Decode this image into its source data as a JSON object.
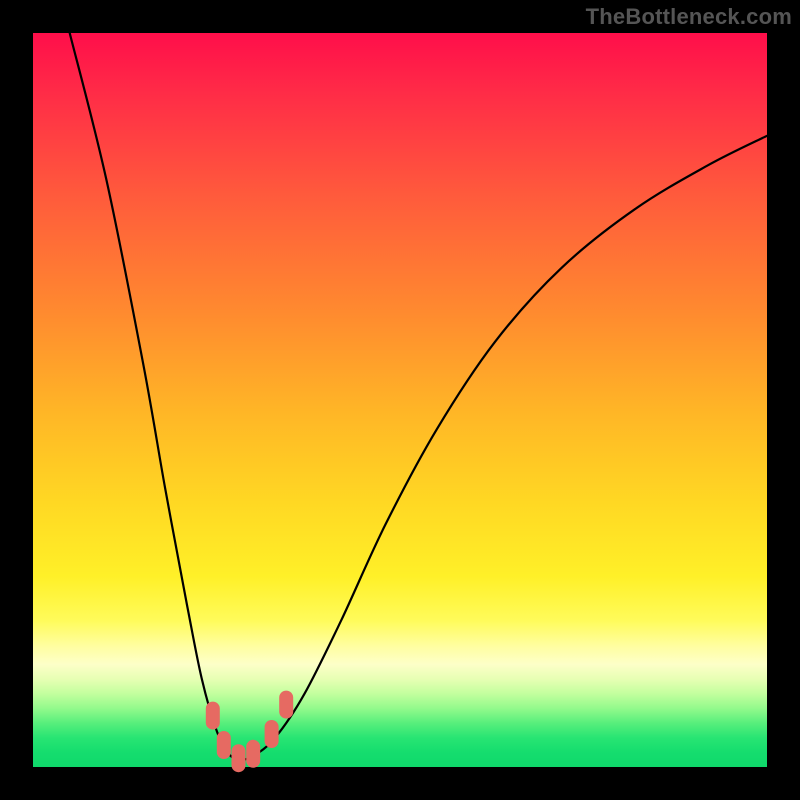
{
  "attribution": "TheBottleneck.com",
  "chart_data": {
    "type": "line",
    "title": "",
    "xlabel": "",
    "ylabel": "",
    "xlim": [
      0,
      100
    ],
    "ylim": [
      0,
      100
    ],
    "series": [
      {
        "name": "bottleneck-curve",
        "x": [
          5,
          10,
          15,
          18,
          21,
          23,
          25,
          26.5,
          28,
          30,
          33,
          37,
          42,
          48,
          55,
          63,
          72,
          82,
          92,
          100
        ],
        "y": [
          100,
          80,
          55,
          38,
          22,
          12,
          5,
          2,
          1,
          1.5,
          4,
          10,
          20,
          33,
          46,
          58,
          68,
          76,
          82,
          86
        ]
      }
    ],
    "markers": {
      "name": "highlight-points",
      "color": "#e66a62",
      "points": [
        {
          "x": 24.5,
          "y": 7
        },
        {
          "x": 26,
          "y": 3
        },
        {
          "x": 28,
          "y": 1.2
        },
        {
          "x": 30,
          "y": 1.8
        },
        {
          "x": 32.5,
          "y": 4.5
        },
        {
          "x": 34.5,
          "y": 8.5
        }
      ]
    },
    "background_gradient": {
      "stops": [
        {
          "pos": 0,
          "color": "#ff0e4a"
        },
        {
          "pos": 50,
          "color": "#ffb726"
        },
        {
          "pos": 80,
          "color": "#fffb5a"
        },
        {
          "pos": 100,
          "color": "#0fd96b"
        }
      ]
    }
  }
}
